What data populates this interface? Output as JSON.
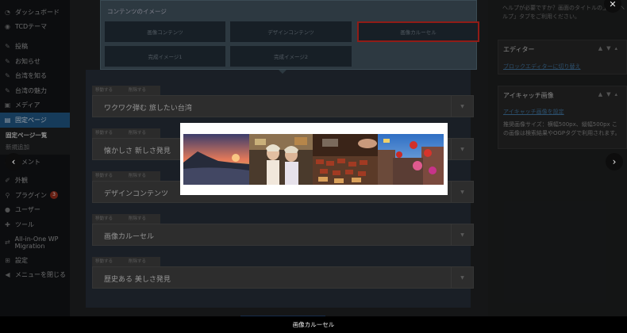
{
  "admin_menu": {
    "items_top": [
      {
        "label": "ダッシュボード",
        "icon": "dashboard-icon"
      },
      {
        "label": "TCDテーマ",
        "icon": "theme-icon"
      }
    ],
    "items_mid": [
      {
        "label": "投稿",
        "icon": "pin-icon"
      },
      {
        "label": "お知らせ",
        "icon": "pin-icon"
      },
      {
        "label": "台湾を知る",
        "icon": "pin-icon"
      },
      {
        "label": "台湾の魅力",
        "icon": "pin-icon"
      },
      {
        "label": "メディア",
        "icon": "media-icon"
      }
    ],
    "active": {
      "label": "固定ページ",
      "icon": "page-icon"
    },
    "submenu": [
      "固定ページ一覧",
      "新規追加"
    ],
    "items_bottom": [
      {
        "label": "コメント",
        "icon": "comment-icon"
      },
      {
        "label": "外観",
        "icon": "brush-icon"
      },
      {
        "label": "プラグイン",
        "icon": "plugin-icon",
        "badge": "3"
      },
      {
        "label": "ユーザー",
        "icon": "user-icon"
      },
      {
        "label": "ツール",
        "icon": "wrench-icon"
      },
      {
        "label": "All-in-One WP Migration",
        "icon": "migration-icon"
      },
      {
        "label": "設定",
        "icon": "settings-icon"
      },
      {
        "label": "メニューを閉じる",
        "icon": "collapse-icon"
      }
    ]
  },
  "content_image": {
    "title": "コンテンツのイメージ",
    "options": [
      "画像コンテンツ",
      "デザインコンテンツ",
      "画像カルーセル",
      "完成イメージ1",
      "完成イメージ2"
    ],
    "selected": "画像カルーセル"
  },
  "blocks": [
    {
      "tab_move": "移動する",
      "tab_delete": "削除する",
      "title": "ワクワク弾む 旅したい台湾"
    },
    {
      "tab_move": "移動する",
      "tab_delete": "削除する",
      "title": "懐かしさ 新しさ発見"
    },
    {
      "tab_move": "移動する",
      "tab_delete": "削除する",
      "title": "デザインコンテンツ"
    },
    {
      "tab_move": "移動する",
      "tab_delete": "削除する",
      "title": "画像カルーセル"
    },
    {
      "tab_move": "移動する",
      "tab_delete": "削除する",
      "title": "歴史ある 美しさ発見"
    }
  ],
  "sidebar": {
    "help_text": "ヘルプが必要ですか？画面のタイトルの上の「ヘルプ」タブをご利用ください。",
    "editor": {
      "title": "エディター",
      "link": "ブロックエディターに切り替え"
    },
    "featured": {
      "title": "アイキャッチ画像",
      "link": "アイキャッチ画像を設定",
      "text": "推奨画像サイズ：横幅500px、縦幅500px この画像は検索結果やOGPタグで利用されます。"
    }
  },
  "lightbox": {
    "caption": "画像カルーセル",
    "prev_icon": "chevron-left-icon",
    "next_icon": "chevron-right-icon",
    "close_icon": "close-icon"
  },
  "colors": {
    "accent_selected": "#c0261f",
    "admin_active": "#1e4f78",
    "link": "#3b6a91"
  }
}
